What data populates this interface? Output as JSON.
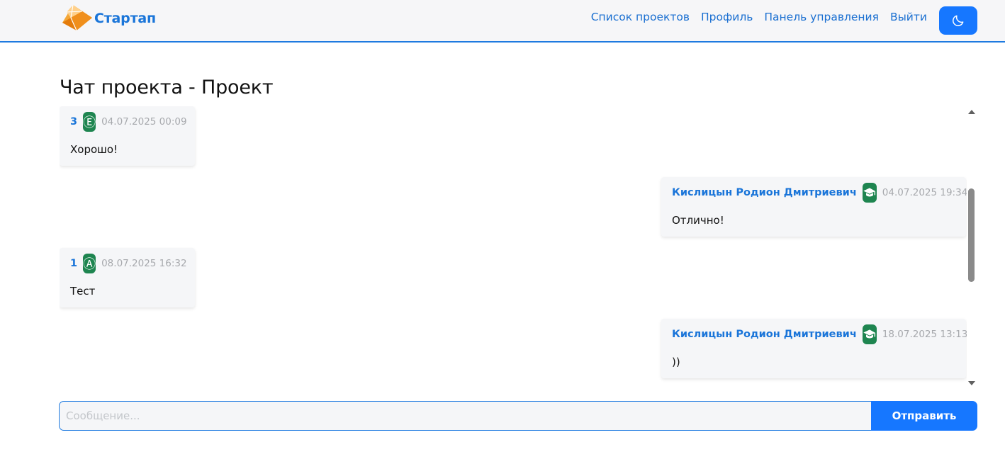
{
  "navbar": {
    "brand": "Стартап",
    "links": [
      "Список проектов",
      "Профиль",
      "Панель управления",
      "Выйти"
    ],
    "theme_icon": "moon-icon",
    "accent_color": "#1677ff"
  },
  "page": {
    "title": "Чат проекта - Проект"
  },
  "messages": [
    {
      "author": "3",
      "badge": "Ⓔ",
      "badge_icon": "letter-e-icon",
      "time": "04.07.2025 00:09",
      "text": "Хорошо!",
      "side": "left"
    },
    {
      "author": "Кислицын Родион Дмитриевич",
      "badge": "",
      "badge_icon": "graduation-cap-icon",
      "time": "04.07.2025 19:34",
      "text": "Отлично!",
      "side": "right"
    },
    {
      "author": "1",
      "badge": "Ⓐ",
      "badge_icon": "letter-a-icon",
      "time": "08.07.2025 16:32",
      "text": "Тест",
      "side": "left"
    },
    {
      "author": "Кислицын Родион Дмитриевич",
      "badge": "",
      "badge_icon": "graduation-cap-icon",
      "time": "18.07.2025 13:13",
      "text": "))",
      "side": "right"
    }
  ],
  "composer": {
    "placeholder": "Сообщение...",
    "value": "",
    "send_label": "Отправить"
  },
  "colors": {
    "badge": "#1e8550",
    "author": "#1a75d9",
    "bubble": "#f5f6f8"
  }
}
